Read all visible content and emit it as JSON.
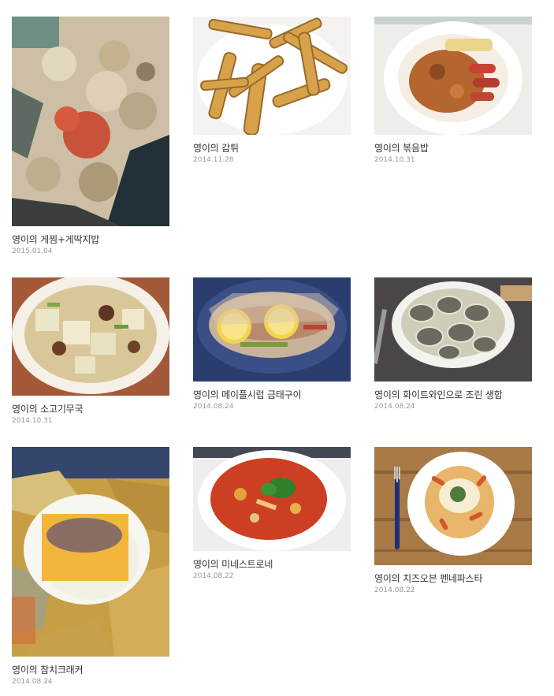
{
  "posts": [
    {
      "title": "영이의 게찜+게딱지밥",
      "date": "2015.01.04",
      "image": "crab-rice-photo"
    },
    {
      "title": "영이의 감튀",
      "date": "2014.11.28",
      "image": "fries-photo"
    },
    {
      "title": "영이의 볶음밥",
      "date": "2014.10.31",
      "image": "fried-rice-photo"
    },
    {
      "title": "영이의 소고기무국",
      "date": "2014.10.31",
      "image": "beef-radish-soup-photo"
    },
    {
      "title": "영이의 메이플시럽 금태구이",
      "date": "2014.08.24",
      "image": "grilled-fish-photo"
    },
    {
      "title": "영이의 화이트와인으로 조린 생합",
      "date": "2014.08.24",
      "image": "clams-photo"
    },
    {
      "title": "영이의 참치크래커",
      "date": "2014.08.24",
      "image": "tuna-cracker-photo"
    },
    {
      "title": "영이의 미네스트로네",
      "date": "2014.08.22",
      "image": "minestrone-photo"
    },
    {
      "title": "영이의 치즈오븐 펜네파스타",
      "date": "2014.08.22",
      "image": "penne-photo"
    }
  ]
}
